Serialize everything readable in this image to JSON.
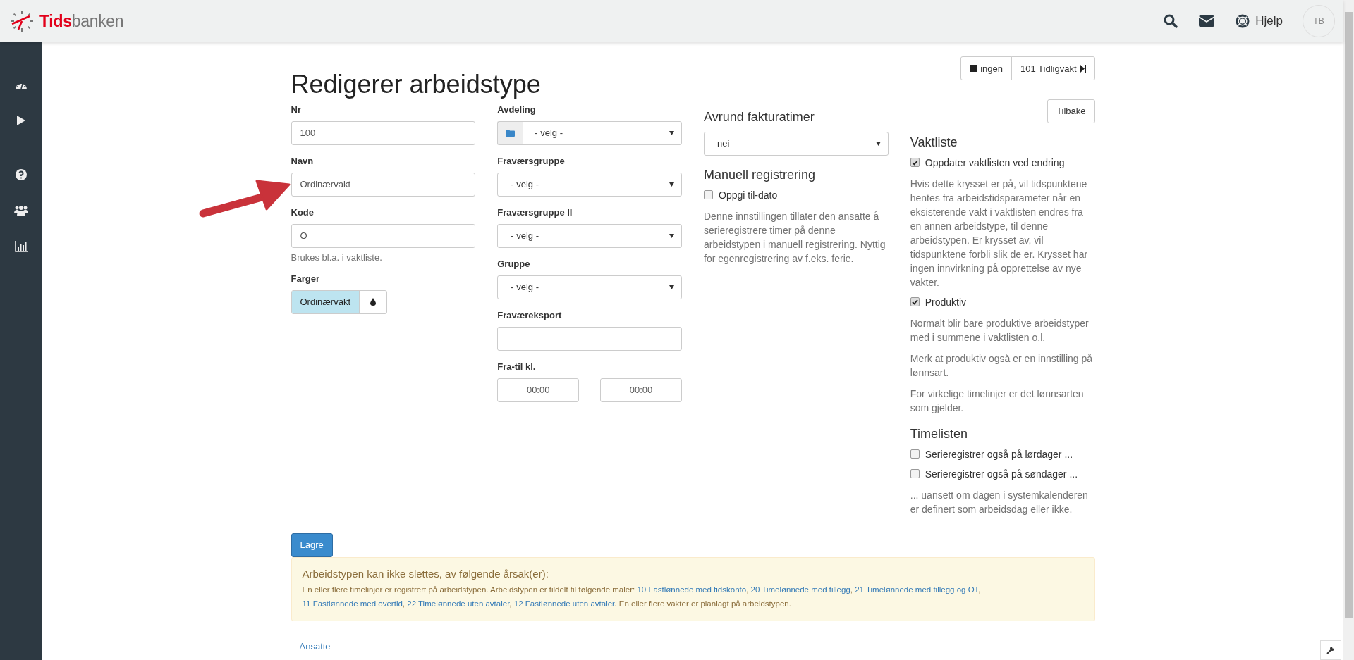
{
  "header": {
    "brand_first": "Tids",
    "brand_second": "banken",
    "help": "Hjelp",
    "avatar": "TB"
  },
  "top_buttons": [
    {
      "kind": "stop",
      "label": "ingen"
    },
    {
      "kind": "next",
      "label": "101 Tidligvakt"
    }
  ],
  "title": "Redigerer arbeidstype",
  "column_1": [
    {
      "kind": "input",
      "label": "Nr",
      "value": "100"
    },
    {
      "kind": "input",
      "label": "Navn",
      "value": "Ordinærvakt"
    },
    {
      "kind": "input",
      "label": "Kode",
      "value": "O",
      "help": "Brukes bl.a. i vaktliste."
    },
    {
      "kind": "color",
      "label": "Farger",
      "value": "Ordinærvakt",
      "color": "#bde4f0"
    }
  ],
  "column_2": [
    {
      "kind": "select-addon",
      "label": "Avdeling",
      "value": "- velg -"
    },
    {
      "kind": "select",
      "label": "Fraværsgruppe",
      "value": "- velg -"
    },
    {
      "kind": "select",
      "label": "Fraværsgruppe II",
      "value": "- velg -"
    },
    {
      "kind": "select",
      "label": "Gruppe",
      "value": "- velg -"
    },
    {
      "kind": "input",
      "label": "Fraværeksport"
    },
    {
      "kind": "time-range",
      "label": "Fra-til kl.",
      "from": "00:00",
      "to": "00:00"
    }
  ],
  "column_3": [
    {
      "kind": "heading",
      "text": "Avrund fakturatimer"
    },
    {
      "kind": "select",
      "text": "nei"
    },
    {
      "kind": "heading",
      "text": "Manuell registrering"
    },
    {
      "kind": "checkbox",
      "text": "Oppgi til-dato",
      "checked": false
    },
    {
      "kind": "paragraph",
      "text": "Denne innstillingen tillater den ansatte å serieregistrere timer på denne arbeidstypen i manuell registrering. Nyttig for egenregistrering av f.eks. ferie."
    }
  ],
  "back_button": "Tilbake",
  "column_4": [
    {
      "kind": "heading",
      "text": "Vaktliste"
    },
    {
      "kind": "checkbox",
      "text": "Oppdater vaktlisten ved endring",
      "checked": true
    },
    {
      "kind": "paragraph",
      "text": "Hvis dette krysset er på, vil tidspunktene hentes fra arbeidstidsparameter når en eksisterende vakt i vaktlisten endres fra en annen arbeidstype, til denne arbeidstypen. Er krysset av, vil tidspunktene forbli slik de er. Krysset har ingen innvirkning på opprettelse av nye vakter."
    },
    {
      "kind": "checkbox",
      "text": "Produktiv",
      "checked": true
    },
    {
      "kind": "paragraph",
      "text": "Normalt blir bare produktive arbeidstyper med i summene i vaktlisten o.l."
    },
    {
      "kind": "paragraph",
      "text": "Merk at produktiv også er en innstilling på lønnsart."
    },
    {
      "kind": "paragraph",
      "text": "For virkelige timelinjer er det lønnsarten som gjelder."
    },
    {
      "kind": "heading",
      "text": "Timelisten"
    },
    {
      "kind": "checkbox",
      "text": "Serieregistrer også på lørdager ...",
      "checked": false
    },
    {
      "kind": "checkbox",
      "text": "Serieregistrer også på søndager ...",
      "checked": false
    },
    {
      "kind": "paragraph",
      "text": "... uansett om dagen i systemkalenderen er definert som arbeidsdag eller ikke."
    }
  ],
  "save_button": "Lagre",
  "warning": {
    "title": "Arbeidstypen kan ikke slettes, av følgende årsak(er):",
    "parts": [
      {
        "kind": "text",
        "text": "En eller flere timelinjer er registrert på arbeidstypen. Arbeidstypen er tildelt til følgende maler: "
      },
      {
        "kind": "link",
        "text": "10 Fastlønnede med tidskonto"
      },
      {
        "kind": "text",
        "text": ", "
      },
      {
        "kind": "link",
        "text": "20 Timelønnede med tillegg"
      },
      {
        "kind": "text",
        "text": ", "
      },
      {
        "kind": "link",
        "text": "21 Timelønnede med tillegg og OT"
      },
      {
        "kind": "text",
        "text": ", "
      },
      {
        "kind": "link",
        "text": "11 Fastlønnede med overtid"
      },
      {
        "kind": "text",
        "text": ", "
      },
      {
        "kind": "link",
        "text": "22 Timelønnede uten avtaler"
      },
      {
        "kind": "text",
        "text": ", "
      },
      {
        "kind": "link",
        "text": "12 Fastlønnede uten avtaler"
      },
      {
        "kind": "text",
        "text": ". En eller flere vakter er planlagt på arbeidstypen."
      }
    ]
  },
  "footer_link": "Ansatte"
}
